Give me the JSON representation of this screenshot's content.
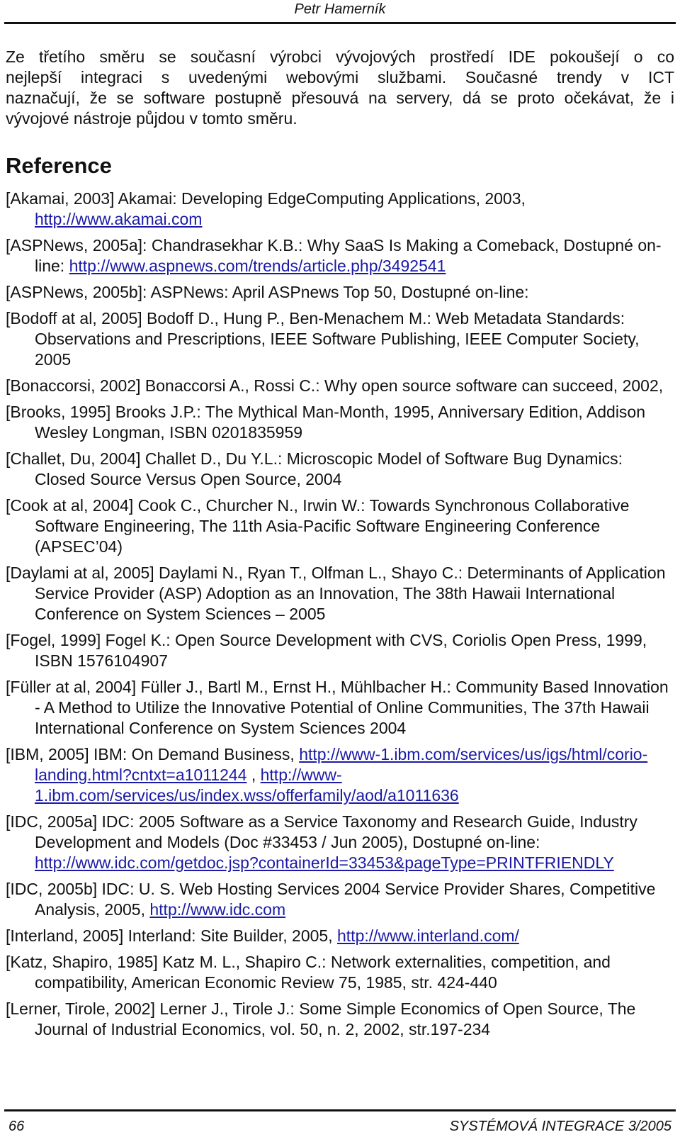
{
  "header": {
    "author": "Petr Hamerník"
  },
  "intro": {
    "lines": [
      "Ze třetího směru se současní výrobci vývojových prostředí IDE pokoušejí o co",
      "nejlepší integraci s uvedenými webovými službami. Současné trendy v ICT",
      "naznačují, že se software postupně přesouvá na servery, dá se proto očekávat, že i",
      "vývojové nástroje půjdou v tomto směru."
    ]
  },
  "references": {
    "heading": "Reference",
    "items": [
      {
        "text": "[Akamai, 2003] Akamai: Developing EdgeComputing Applications, 2003, ",
        "link": "http://www.akamai.com",
        "tail": ""
      },
      {
        "text": "[ASPNews, 2005a]: Chandrasekhar K.B.: Why SaaS Is Making a Comeback, Dostupné on-line:  ",
        "link": "http://www.aspnews.com/trends/article.php/3492541",
        "tail": ""
      },
      {
        "text": "[ASPNews, 2005b]: ASPNews: April ASPnews Top 50, Dostupné on-line:",
        "link": "",
        "tail": ""
      },
      {
        "text": "[Bodoff at al, 2005] Bodoff  D., Hung P., Ben-Menachem M.: Web Metadata Standards: Observations and Prescriptions, IEEE Software Publishing, IEEE Computer Society, 2005",
        "link": "",
        "tail": ""
      },
      {
        "text": "[Bonaccorsi, 2002] Bonaccorsi A., Rossi C.: Why open source software can succeed, 2002,",
        "link": "",
        "tail": ""
      },
      {
        "text": "[Brooks, 1995] Brooks J.P.: The Mythical Man-Month, 1995, Anniversary Edition, Addison Wesley Longman, ISBN 0201835959",
        "link": "",
        "tail": ""
      },
      {
        "text": "[Challet, Du, 2004] Challet D., Du Y.L.: Microscopic Model of Software Bug Dynamics: Closed Source Versus Open Source, 2004",
        "link": "",
        "tail": ""
      },
      {
        "text": "[Cook at al, 2004] Cook C., Churcher N., Irwin W.: Towards Synchronous Collaborative Software Engineering, The 11th Asia-Pacific Software Engineering Conference (APSEC’04)",
        "link": "",
        "tail": ""
      },
      {
        "text": "[Daylami at al, 2005] Daylami N., Ryan T., Olfman L., Shayo C.: Determinants of Application Service Provider (ASP) Adoption as an Innovation, The 38th Hawaii International Conference on System Sciences – 2005",
        "link": "",
        "tail": ""
      },
      {
        "text": "[Fogel, 1999] Fogel K.: Open Source Development with CVS, Coriolis Open Press, 1999, ISBN 1576104907",
        "link": "",
        "tail": ""
      },
      {
        "text": "[Füller at al, 2004] Füller J., Bartl M., Ernst H., Mühlbacher H.: Community Based Innovation - A Method to Utilize the Innovative Potential of Online Communities, The 37th Hawaii International Conference on System Sciences 2004",
        "link": "",
        "tail": ""
      },
      {
        "text": "[IBM, 2005] IBM: On Demand Business,  ",
        "link": "http://www-1.ibm.com/services/us/igs/html/corio-landing.html?cntxt=a1011244",
        "tail": " , ",
        "link2": "http://www-1.ibm.com/services/us/index.wss/offerfamily/aod/a1011636"
      },
      {
        "text": "[IDC, 2005a] IDC: 2005 Software as a Service Taxonomy and Research Guide, Industry Development and Models (Doc #33453 / Jun 2005), Dostupné on-line: ",
        "link": "http://www.idc.com/getdoc.jsp?containerId=33453&pageType=PRINTFRIENDLY",
        "tail": ""
      },
      {
        "text": "[IDC, 2005b] IDC: U. S. Web Hosting Services 2004 Service Provider Shares, Competitive Analysis, 2005, ",
        "link": "http://www.idc.com",
        "tail": ""
      },
      {
        "text": "[Interland, 2005] Interland: Site Builder, 2005, ",
        "link": "http://www.interland.com/",
        "tail": ""
      },
      {
        "text": "[Katz, Shapiro, 1985] Katz M. L., Shapiro C.: Network externalities, competition, and compatibility, American Economic Review 75, 1985, str. 424-440",
        "link": "",
        "tail": ""
      },
      {
        "text": "[Lerner, Tirole, 2002] Lerner J., Tirole J.: Some Simple Economics of Open Source, The Journal of Industrial Economics, vol. 50, n. 2, 2002, str.197-234",
        "link": "",
        "tail": ""
      }
    ]
  },
  "footer": {
    "page_number": "66",
    "journal": "SYSTÉMOVÁ INTEGRACE 3/2005"
  },
  "colors": {
    "link": "#1a1aa6",
    "text": "#111111"
  }
}
